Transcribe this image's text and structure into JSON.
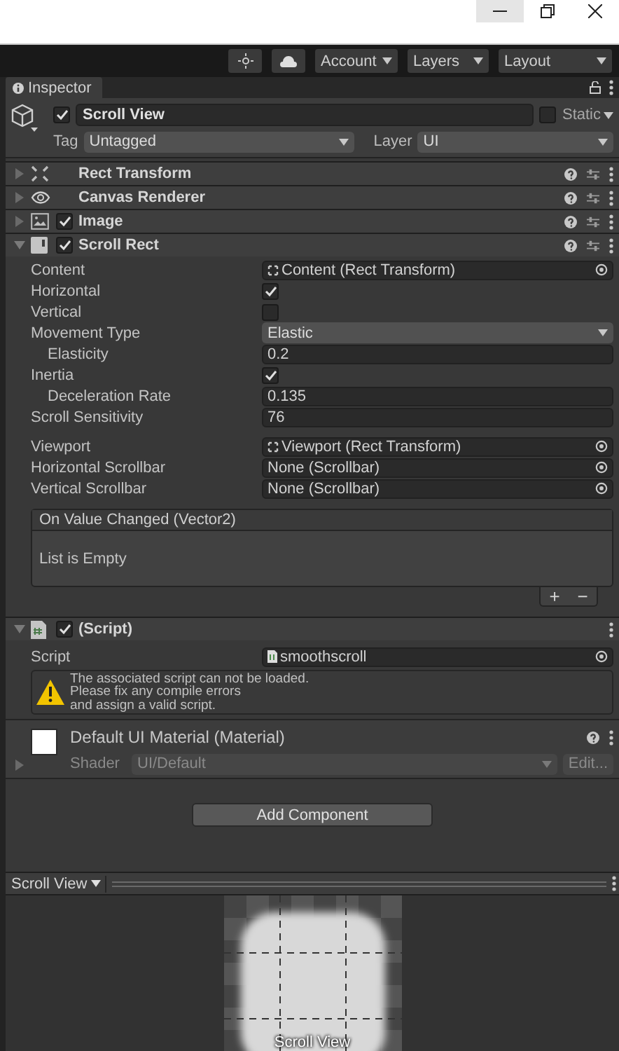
{
  "toolbar": {
    "dropdowns": [
      {
        "label": "Account"
      },
      {
        "label": "Layers"
      },
      {
        "label": "Layout"
      }
    ]
  },
  "inspector": {
    "tab": "Inspector",
    "object": {
      "active": true,
      "name": "Scroll View",
      "static": false,
      "static_label": "Static",
      "tag_label": "Tag",
      "tag": "Untagged",
      "layer_label": "Layer",
      "layer": "UI"
    },
    "components": [
      {
        "kind": "rect-transform",
        "name": "Rect Transform",
        "expanded": false
      },
      {
        "kind": "canvas-renderer",
        "name": "Canvas Renderer",
        "expanded": false
      },
      {
        "kind": "image",
        "name": "Image",
        "expanded": false,
        "enabled": true
      },
      {
        "kind": "scroll-rect",
        "name": "Scroll Rect",
        "expanded": true,
        "enabled": true
      }
    ],
    "scroll_rect": {
      "properties": [
        {
          "kind": "transform-ref",
          "label": "Content",
          "value": "Content (Rect Transform)"
        },
        {
          "kind": "toggle",
          "label": "Horizontal",
          "checked": true
        },
        {
          "kind": "toggle",
          "label": "Vertical",
          "checked": false
        },
        {
          "kind": "dropdown",
          "label": "Movement Type",
          "value": "Elastic"
        },
        {
          "kind": "number",
          "label": "Elasticity",
          "value": "0.2",
          "indented": true
        },
        {
          "kind": "toggle",
          "label": "Inertia",
          "checked": true
        },
        {
          "kind": "number",
          "label": "Deceleration Rate",
          "value": "0.135",
          "indented": true
        },
        {
          "kind": "number",
          "label": "Scroll Sensitivity",
          "value": "76"
        }
      ],
      "references": [
        {
          "kind": "transform-ref",
          "label": "Viewport",
          "value": "Viewport (Rect Transform)"
        },
        {
          "kind": "ref",
          "label": "Horizontal Scrollbar",
          "value": "None (Scrollbar)"
        },
        {
          "kind": "ref",
          "label": "Vertical Scrollbar",
          "value": "None (Scrollbar)"
        }
      ],
      "event": {
        "title": "On Value Changed (Vector2)",
        "empty_text": "List is Empty",
        "add": "+",
        "remove": "−"
      }
    },
    "script_component": {
      "name": "(Script)",
      "expanded": true,
      "enabled": true,
      "script_label": "Script",
      "script": "smoothscroll",
      "warning": "The associated script can not be loaded.\nPlease fix any compile errors\nand assign a valid script."
    },
    "material": {
      "name": "Default UI Material (Material)",
      "expanded": false,
      "shader_label": "Shader",
      "shader": "UI/Default",
      "edit": "Edit..."
    },
    "add_component": "Add Component"
  },
  "preview": {
    "title": "Scroll View",
    "label": "Scroll View"
  }
}
